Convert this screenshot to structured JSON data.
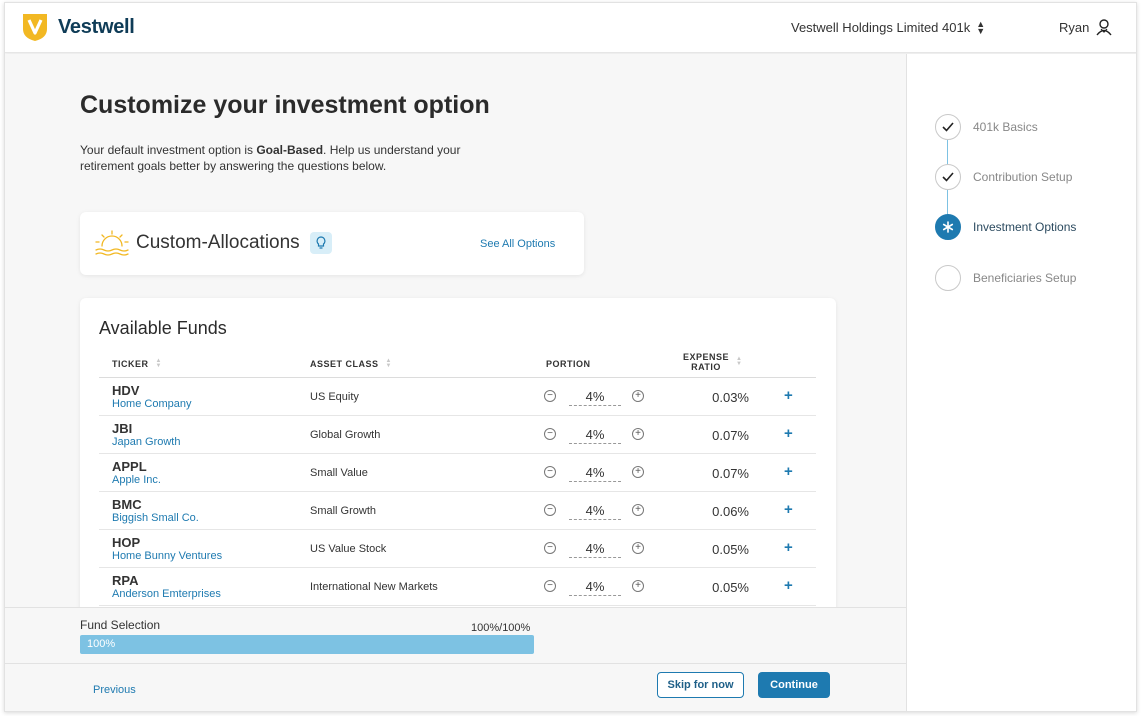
{
  "header": {
    "brand": "Vestwell",
    "company_selector": "Vestwell Holdings Limited 401k",
    "user_name": "Ryan"
  },
  "main": {
    "title": "Customize your investment option",
    "intro_prefix": "Your default investment option is ",
    "intro_bold": "Goal-Based",
    "intro_suffix": ". Help us understand your retirement goals better by answering the questions below."
  },
  "allocation": {
    "title": "Custom-Allocations",
    "see_all": "See All Options"
  },
  "funds": {
    "title": "Available Funds",
    "columns": {
      "ticker": "TICKER",
      "asset_class": "ASSET CLASS",
      "portion": "PORTION",
      "expense_ratio_line1": "EXPENSE",
      "expense_ratio_line2": "RATIO"
    },
    "rows": [
      {
        "ticker": "HDV",
        "name": "Home Company",
        "asset_class": "US Equity",
        "portion": "4%",
        "ratio": "0.03%"
      },
      {
        "ticker": "JBI",
        "name": "Japan Growth",
        "asset_class": "Global Growth",
        "portion": "4%",
        "ratio": "0.07%"
      },
      {
        "ticker": "APPL",
        "name": "Apple Inc.",
        "asset_class": "Small Value",
        "portion": "4%",
        "ratio": "0.07%"
      },
      {
        "ticker": "BMC",
        "name": "Biggish Small Co.",
        "asset_class": "Small Growth",
        "portion": "4%",
        "ratio": "0.06%"
      },
      {
        "ticker": "HOP",
        "name": "Home Bunny Ventures",
        "asset_class": "US Value Stock",
        "portion": "4%",
        "ratio": "0.05%"
      },
      {
        "ticker": "RPA",
        "name": "Anderson Emterprises",
        "asset_class": "International New Markets",
        "portion": "4%",
        "ratio": "0.05%"
      }
    ]
  },
  "fund_selection": {
    "label": "Fund Selection",
    "total": "100%/100%",
    "bar_text": "100%",
    "progress": 1.0
  },
  "footer": {
    "previous": "Previous",
    "skip": "Skip for now",
    "continue": "Continue"
  },
  "stepper": {
    "steps": [
      {
        "label": "401k Basics",
        "state": "done"
      },
      {
        "label": "Contribution Setup",
        "state": "done"
      },
      {
        "label": "Investment Options",
        "state": "active"
      },
      {
        "label": "Beneficiaries Setup",
        "state": "pending"
      }
    ]
  },
  "colors": {
    "accent": "#1e7ab0",
    "progress_fill": "#7dc2e3",
    "brand_gold": "#f2b823",
    "brand_navy": "#0f3c57"
  }
}
